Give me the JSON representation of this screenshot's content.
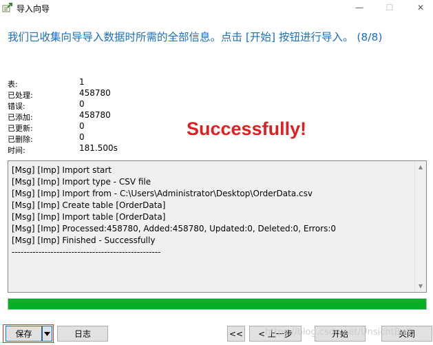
{
  "window": {
    "title": "导入向导",
    "minimize": "—",
    "maximize": "☐",
    "close": "✕"
  },
  "heading": "我们已收集向导导入数据时所需的全部信息。点击 [开始] 按钮进行导入。 (8/8)",
  "stats": [
    {
      "label": "表:",
      "value": "1"
    },
    {
      "label": "已处理:",
      "value": "458780"
    },
    {
      "label": "错误:",
      "value": "0"
    },
    {
      "label": "已添加:",
      "value": "458780"
    },
    {
      "label": "已更新:",
      "value": "0"
    },
    {
      "label": "已删除:",
      "value": "0"
    },
    {
      "label": "时间:",
      "value": "181.500s"
    }
  ],
  "banner": "Successfully!",
  "log": [
    "[Msg] [Imp] Import start",
    "[Msg] [Imp] Import type - CSV file",
    "[Msg] [Imp] Import from - C:\\Users\\Administrator\\Desktop\\OrderData.csv",
    "[Msg] [Imp] Create table [OrderData]",
    "[Msg] [Imp] Import table [OrderData]",
    "[Msg] [Imp] Processed:458780, Added:458780, Updated:0, Deleted:0, Errors:0",
    "[Msg] [Imp] Finished - Successfully",
    "--------------------------------------------------"
  ],
  "progress": {
    "fraction": 1.0,
    "color": "#06b025"
  },
  "buttons": {
    "save": "保存",
    "log": "日志",
    "first": "<<",
    "prev": "< 上一步",
    "start": "开始",
    "close": "关闭"
  },
  "watermark": "https://blog.csdn.net/UnsichtBait"
}
